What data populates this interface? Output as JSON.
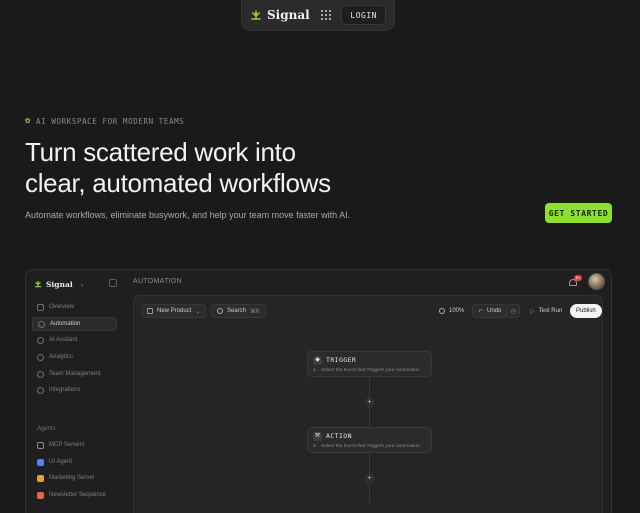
{
  "nav": {
    "brand": "Signal",
    "login_label": "LOGIN"
  },
  "hero": {
    "eyebrow": "AI WORKSPACE FOR MODERN TEAMS",
    "title_line1": "Turn scattered work into",
    "title_line2": "clear, automated workflows",
    "subtitle": "Automate workflows, eliminate busywork, and help your team move faster with AI.",
    "cta_label": "GET STARTED"
  },
  "app": {
    "brand": "Signal",
    "page_title": "AUTOMATION",
    "notification_count": "9+",
    "sidebar": {
      "items": [
        {
          "label": "Overview",
          "icon": "grid-icon"
        },
        {
          "label": "Automation",
          "icon": "automation-icon",
          "active": true
        },
        {
          "label": "AI Assitant",
          "icon": "sparkle-icon"
        },
        {
          "label": "Analytics",
          "icon": "chart-icon"
        },
        {
          "label": "Team Management",
          "icon": "users-icon"
        },
        {
          "label": "Integrations",
          "icon": "plug-icon"
        }
      ],
      "agents_label": "Agents",
      "agents": [
        {
          "label": "MCP Servers",
          "icon": "server-icon",
          "color": "#8a8a8a"
        },
        {
          "label": "UI Agent",
          "icon": "agent-icon",
          "color": "#5b7ee8"
        },
        {
          "label": "Marketing Server",
          "icon": "megaphone-icon",
          "color": "#e0a23a"
        },
        {
          "label": "Newsletter Sequence",
          "icon": "mail-icon",
          "color": "#e06a4a"
        }
      ]
    },
    "toolbar": {
      "product_label": "New Product",
      "search_label": "Search",
      "search_shortcut": "⌘K",
      "zoom": "100%",
      "undo_label": "Undo",
      "test_label": "Test Run",
      "publish_label": "Publish"
    },
    "nodes": [
      {
        "title": "TRIGGER",
        "index": "1.",
        "desc": "Select the Event that Triggers your automation"
      },
      {
        "title": "ACTION",
        "index": "2.",
        "desc": "Select the Event that Triggers your automation"
      }
    ]
  },
  "colors": {
    "accent": "#8de02e",
    "background": "#1a1a1a",
    "badge": "#e0443e"
  }
}
